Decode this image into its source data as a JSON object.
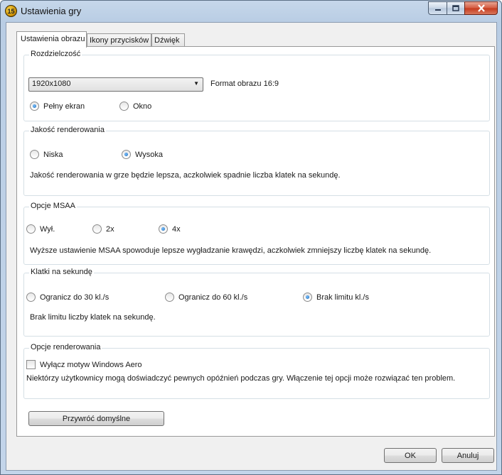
{
  "window": {
    "title": "Ustawienia gry",
    "icon_text": "15",
    "icons": [
      "app-icon",
      "minimize-icon",
      "maximize-icon",
      "close-icon"
    ]
  },
  "tabs": [
    {
      "label": "Ustawienia obrazu",
      "active": true
    },
    {
      "label": "Ikony przycisków",
      "active": false
    },
    {
      "label": "Dźwięk",
      "active": false
    }
  ],
  "resolution": {
    "title": "Rozdzielczość",
    "selected": "1920x1080",
    "aspect_label": "Format obrazu 16:9",
    "modes": [
      {
        "label": "Pełny ekran",
        "checked": true
      },
      {
        "label": "Okno",
        "checked": false
      }
    ]
  },
  "render_quality": {
    "title": "Jakość renderowania",
    "options": [
      {
        "label": "Niska",
        "checked": false
      },
      {
        "label": "Wysoka",
        "checked": true
      }
    ],
    "description": "Jakość renderowania w grze będzie lepsza, aczkolwiek spadnie liczba klatek na sekundę."
  },
  "msaa": {
    "title": "Opcje MSAA",
    "options": [
      {
        "label": "Wył.",
        "checked": false
      },
      {
        "label": "2x",
        "checked": false
      },
      {
        "label": "4x",
        "checked": true
      }
    ],
    "description": "Wyższe ustawienie MSAA spowoduje lepsze wygładzanie krawędzi, aczkolwiek zmniejszy liczbę klatek na sekundę."
  },
  "fps": {
    "title": "Klatki na sekundę",
    "options": [
      {
        "label": "Ogranicz do 30 kl./s",
        "checked": false
      },
      {
        "label": "Ogranicz do 60 kl./s",
        "checked": false
      },
      {
        "label": "Brak limitu kl./s",
        "checked": true
      }
    ],
    "description": "Brak limitu liczby klatek na sekundę."
  },
  "render_options": {
    "title": "Opcje renderowania",
    "aero_label": "Wyłącz motyw Windows Aero",
    "aero_checked": false,
    "description": "Niektórzy użytkownicy mogą doświadczyć pewnych opóźnień podczas gry. Włączenie tej opcji może rozwiązać ten problem."
  },
  "buttons": {
    "restore_defaults": "Przywróć domyślne",
    "ok": "OK",
    "cancel": "Anuluj"
  }
}
